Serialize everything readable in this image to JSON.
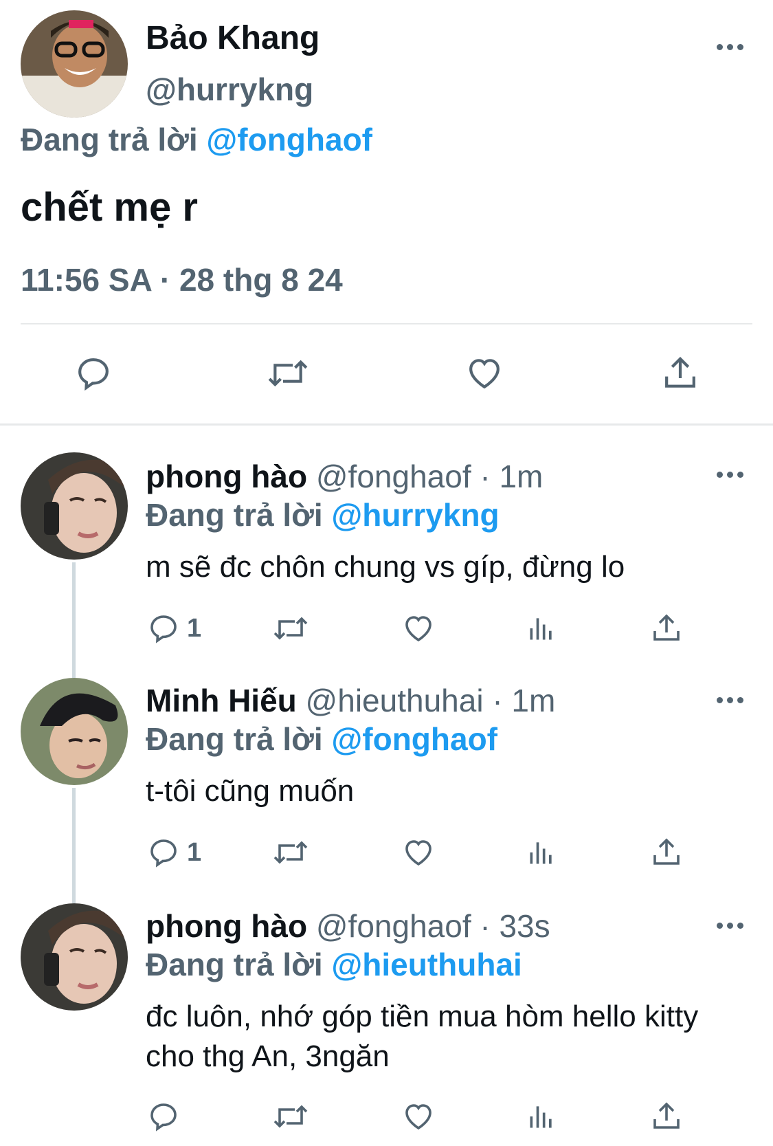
{
  "main_tweet": {
    "author_name": "Bảo Khang",
    "author_handle": "@hurrykng",
    "reply_prefix": "Đang trả lời",
    "reply_mention": "@fonghaof",
    "text": "chết mẹ r",
    "timestamp": "11:56 SA · 28 thg 8 24",
    "actions": [
      "reply-icon",
      "retweet-icon",
      "like-icon",
      "share-icon"
    ]
  },
  "replies": [
    {
      "name": "phong hào",
      "handle_time": "@fonghaof · 1m",
      "reply_prefix": "Đang trả lời",
      "reply_mention": "@hurrykng",
      "text": "m sẽ đc chôn chung vs gíp, đừng lo",
      "reply_count": "1"
    },
    {
      "name": "Minh Hiếu",
      "handle_time": "@hieuthuhai · 1m",
      "reply_prefix": "Đang trả lời",
      "reply_mention": "@fonghaof",
      "text": "t-tôi cũng muốn",
      "reply_count": "1"
    },
    {
      "name": "phong hào",
      "handle_time": "@fonghaof · 33s",
      "reply_prefix": "Đang trả lời",
      "reply_mention": "@hieuthuhai",
      "text": "đc luôn, nhớ góp tiền mua hòm hello kitty cho thg An, 3ngăn",
      "reply_count": ""
    }
  ],
  "colors": {
    "text": "#0f1419",
    "secondary": "#536471",
    "accent": "#1d9bf0",
    "divider": "#e7e9ea"
  }
}
